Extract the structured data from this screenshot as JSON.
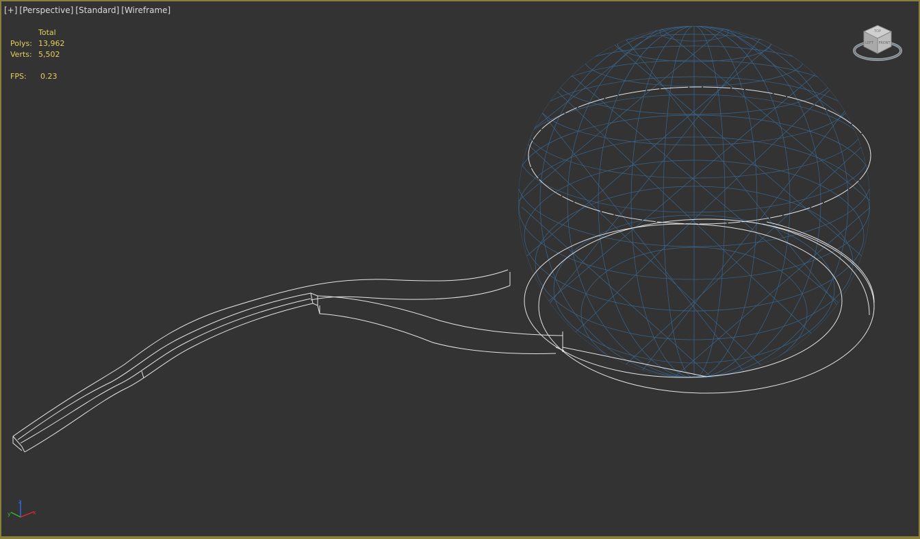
{
  "viewport": {
    "menu_label": "[+]",
    "view_label": "[Perspective]",
    "shading_label": "[Standard]",
    "render_mode_label": "[Wireframe]"
  },
  "stats": {
    "header": "Total",
    "polys_label": "Polys:",
    "polys_value": "13,962",
    "verts_label": "Verts:",
    "verts_value": "5,502",
    "fps_label": "FPS:",
    "fps_value": "0.23"
  },
  "viewcube": {
    "icon": "viewcube-icon",
    "face_left": "LEFT",
    "face_front": "FRONT",
    "face_top": "TOP"
  },
  "axis_tripod": {
    "icon": "axis-tripod-icon",
    "x_label": "x",
    "y_label": "y",
    "z_label": "z"
  },
  "colors": {
    "viewport_bg": "#333333",
    "active_border": "#8a7f3a",
    "wire_white": "#e6e6e6",
    "wire_blue": "#3c6f9e",
    "stats_text": "#e6d15a"
  }
}
